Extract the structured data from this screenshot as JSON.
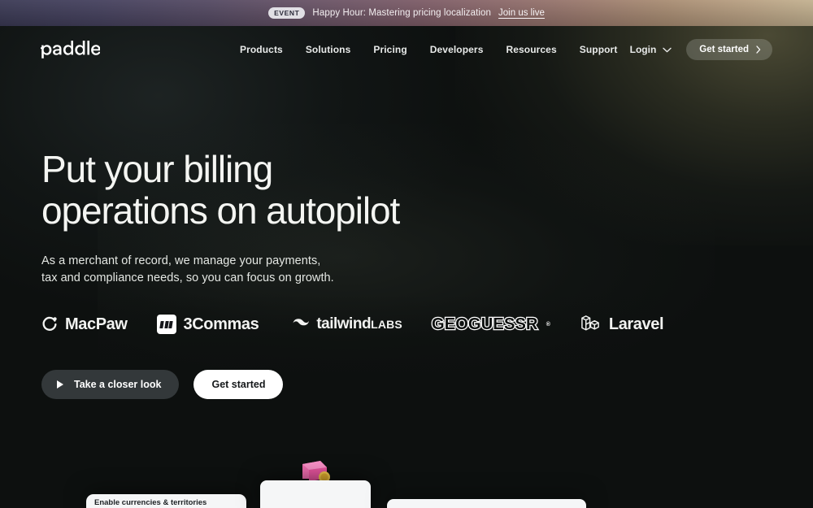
{
  "banner": {
    "badge": "EVENT",
    "text": "Happy Hour: Mastering pricing localization",
    "link": "Join us live"
  },
  "nav": {
    "logo_text": "paddle",
    "links": [
      {
        "label": "Products"
      },
      {
        "label": "Solutions"
      },
      {
        "label": "Pricing"
      },
      {
        "label": "Developers"
      },
      {
        "label": "Resources"
      },
      {
        "label": "Support"
      }
    ],
    "login_label": "Login",
    "login_icon": "chevron-down-icon",
    "cta_label": "Get started",
    "cta_icon": "chevron-right-icon"
  },
  "hero": {
    "headline_line1": "Put your billing",
    "headline_line2": "operations on autopilot",
    "subhead_line1": "As a merchant of record, we manage your payments,",
    "subhead_line2": "tax and compliance needs, so you can focus on growth.",
    "primary_cta": "Take a closer look",
    "primary_cta_icon": "play-icon",
    "secondary_cta": "Get started"
  },
  "customer_logos": [
    {
      "name": "MacPaw",
      "icon": "macpaw-swirl-icon"
    },
    {
      "name": "3Commas",
      "icon": "threecommas-bars-icon"
    },
    {
      "name_main": "tailwind",
      "name_sub": "LABS",
      "icon": "tailwind-waves-icon"
    },
    {
      "name": "GEOGUESSR",
      "trademark": "®",
      "icon": "geoguessr-pin-icon"
    },
    {
      "name": "Laravel",
      "icon": "laravel-mark-icon"
    }
  ],
  "preview_cards": [
    {
      "label": "Enable currencies & territories"
    },
    {
      "label": "",
      "icon": "pink-wallet-illustration"
    },
    {
      "label": ""
    }
  ],
  "colors": {
    "background": "#0d100f",
    "banner_left": "#3b3a55",
    "banner_right": "#c3b190",
    "accent_light": "#ffffff",
    "button_dark": "#33383a",
    "card": "#f5f6f7",
    "wallet_pink": "#f06eb0",
    "coin_yellow": "#f2c84b"
  }
}
